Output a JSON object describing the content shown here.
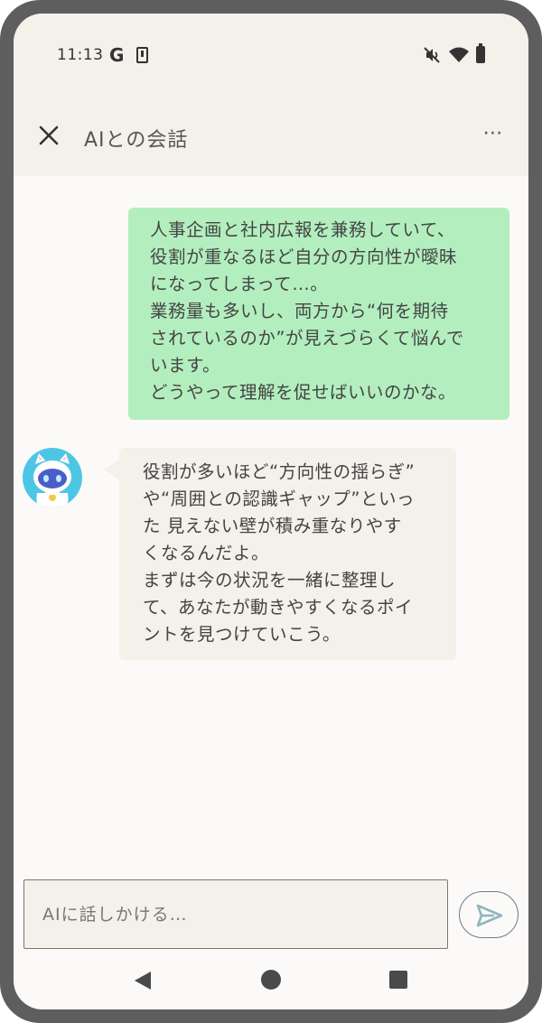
{
  "status_bar": {
    "time": "11:13",
    "google_icon_text": "G",
    "icons": [
      "google-icon",
      "download-icon",
      "mute-icon",
      "wifi-icon",
      "battery-icon"
    ]
  },
  "header": {
    "title": "AIとの会話",
    "close_icon": "close-icon",
    "more_label": "⋯"
  },
  "messages": [
    {
      "sender": "user",
      "lines": [
        "人事企画と社内広報を兼務していて、",
        "役割が重なるほど自分の方向性が曖昧",
        "になってしまって…。",
        "業務量も多いし、両方から“何を期待",
        "されているのか”が見えづらくて悩んで",
        "います。",
        "どうやって理解を促せばいいのかな。"
      ]
    },
    {
      "sender": "ai",
      "lines": [
        "役割が多いほど“方向性の揺らぎ”",
        "や“周囲との認識ギャップ”といっ",
        "た 見えない壁が積み重なりやす",
        "くなるんだよ。",
        "まずは今の状況を一緒に整理し",
        "て、あなたが動きやすくなるポイ",
        "ントを見つけていこう。"
      ]
    }
  ],
  "composer": {
    "placeholder": "AIに話しかける…",
    "send_icon": "send-icon"
  },
  "nav": {
    "back_icon": "back-icon",
    "home_icon": "home-icon",
    "recents_icon": "recents-icon"
  },
  "colors": {
    "frame": "#5e5e5e",
    "header_bg": "#f4f0ea",
    "screen_bg": "#fbfaf8",
    "user_bubble": "#b3eebf",
    "ai_bubble": "#f4f0ea",
    "avatar_bg": "#4dc6e6"
  }
}
